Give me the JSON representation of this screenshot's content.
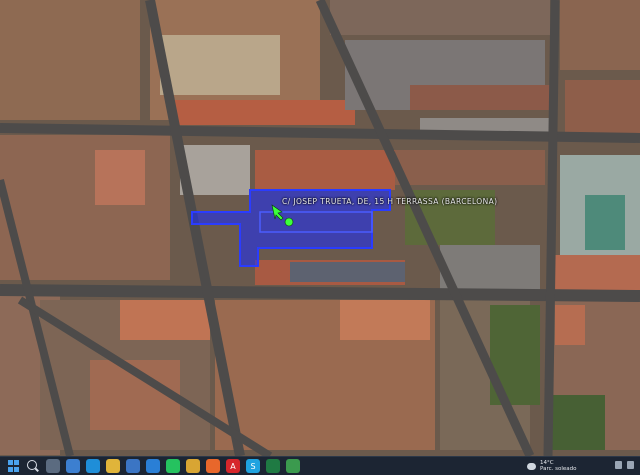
{
  "map": {
    "parcel_label": "C/ JOSEP TRUETA, DE, 15 H TERRASSA (BARCELONA)",
    "highlight_color": "#1a2cff",
    "marker_color": "#3cff3c"
  },
  "taskbar": {
    "icons": [
      {
        "name": "start-icon"
      },
      {
        "name": "search-icon"
      },
      {
        "name": "task-view-icon",
        "color": "#5b6b80"
      },
      {
        "name": "widgets-icon",
        "color": "#3c7fd0"
      },
      {
        "name": "edge-icon",
        "color": "#1f8ed8"
      },
      {
        "name": "file-explorer-icon",
        "color": "#e0b43a"
      },
      {
        "name": "store-icon",
        "color": "#3b75c4"
      },
      {
        "name": "mail-icon",
        "color": "#2a7fd6"
      },
      {
        "name": "whatsapp-icon",
        "color": "#25c25f"
      },
      {
        "name": "chrome-icon",
        "color": "#d8a533"
      },
      {
        "name": "firefox-icon",
        "color": "#e8672b"
      },
      {
        "name": "acrobat-icon",
        "color": "#d6262b",
        "glyph": "A"
      },
      {
        "name": "skype-icon",
        "color": "#1fa3e0",
        "glyph": "S"
      },
      {
        "name": "excel-icon",
        "color": "#1f7a43"
      },
      {
        "name": "maps-icon",
        "color": "#3b9a4e"
      }
    ],
    "weather": {
      "temp": "14°C",
      "condition": "Parc. soleado"
    }
  }
}
